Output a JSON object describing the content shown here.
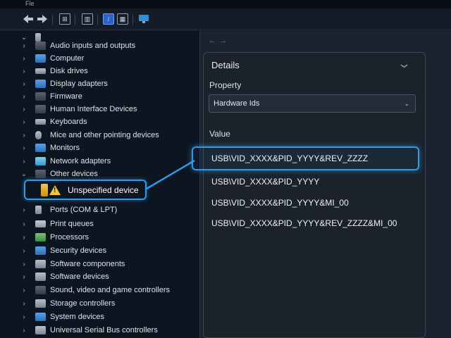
{
  "window": {
    "title": "Fle"
  },
  "tree": {
    "items": [
      {
        "label": "Audio inputs and outputs",
        "icon": "speaker-icon",
        "expanded": false
      },
      {
        "label": "Computer",
        "icon": "computer-icon",
        "expanded": false
      },
      {
        "label": "Disk drives",
        "icon": "disk-icon",
        "expanded": false
      },
      {
        "label": "Display adapters",
        "icon": "display-adapter-icon",
        "expanded": false
      },
      {
        "label": "Firmware",
        "icon": "firmware-icon",
        "expanded": false
      },
      {
        "label": "Human Interface Devices",
        "icon": "hid-icon",
        "expanded": false
      },
      {
        "label": "Keyboards",
        "icon": "keyboard-icon",
        "expanded": false
      },
      {
        "label": "Mice and other pointing devices",
        "icon": "mouse-icon",
        "expanded": false
      },
      {
        "label": "Monitors",
        "icon": "monitor-icon",
        "expanded": false
      },
      {
        "label": "Network adapters",
        "icon": "network-icon",
        "expanded": false
      },
      {
        "label": "Other devices",
        "icon": "other-devices-icon",
        "expanded": true
      },
      {
        "label": "Ports (COM & LPT)",
        "icon": "port-icon",
        "expanded": false
      },
      {
        "label": "Print queues",
        "icon": "printer-icon",
        "expanded": false
      },
      {
        "label": "Processors",
        "icon": "processor-icon",
        "expanded": false
      },
      {
        "label": "Security devices",
        "icon": "security-icon",
        "expanded": false
      },
      {
        "label": "Software components",
        "icon": "software-component-icon",
        "expanded": false
      },
      {
        "label": "Software devices",
        "icon": "software-device-icon",
        "expanded": false
      },
      {
        "label": "Sound, video and game controllers",
        "icon": "sound-icon",
        "expanded": false
      },
      {
        "label": "Storage controllers",
        "icon": "storage-icon",
        "expanded": false
      },
      {
        "label": "System devices",
        "icon": "system-icon",
        "expanded": false
      },
      {
        "label": "Universal Serial Bus controllers",
        "icon": "usb-icon",
        "expanded": false
      }
    ],
    "selected_child": {
      "label": "Unspecified device",
      "icon": "warning-icon"
    }
  },
  "details": {
    "title": "Details",
    "property_label": "Property",
    "property_value": "Hardware Ids",
    "value_label": "Value",
    "values": [
      "USB\\VID_XXXX&PID_YYYY&REV_ZZZZ",
      "USB\\VID_XXXX&PID_YYYY",
      "USB\\VID_XXXX&PID_YYYY&MI_00",
      "USB\\VID_XXXX&PID_YYYY&REV_ZZZZ&MI_00"
    ]
  },
  "colors": {
    "accent": "#2f9be8",
    "warning": "#f3c63a",
    "background": "#0d1520"
  }
}
